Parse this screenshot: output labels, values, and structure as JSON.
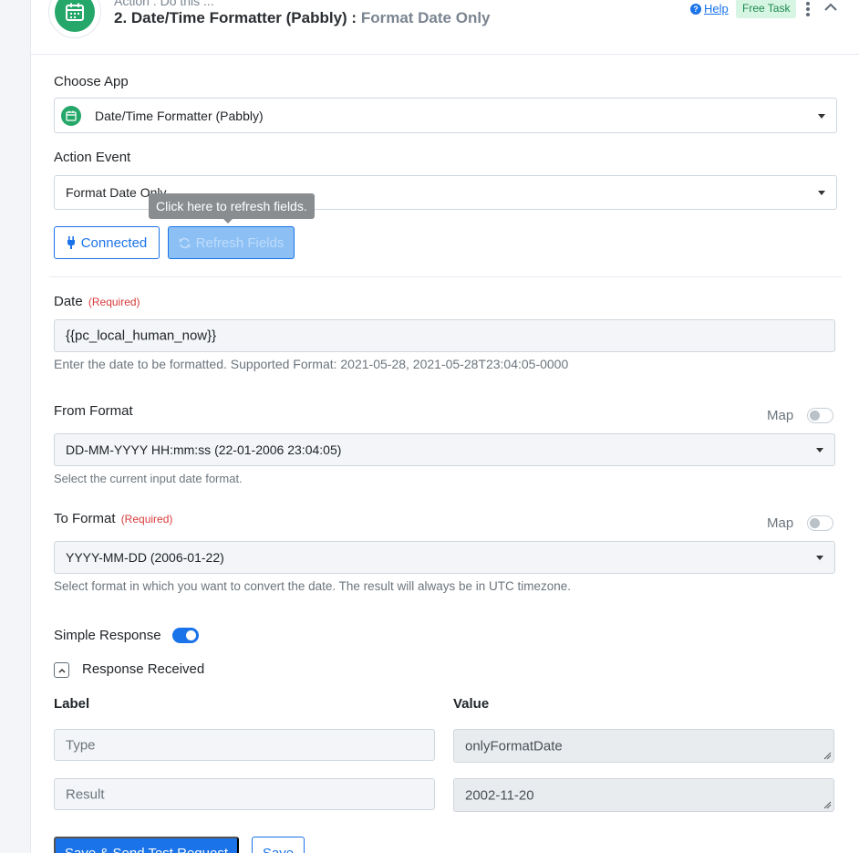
{
  "header": {
    "subtitle": "Action : Do this ...",
    "step_title": "2. Date/Time Formatter (Pabbly)",
    "separator": " : ",
    "event_name": "Format Date Only",
    "help_label": "Help",
    "badge": "Free Task"
  },
  "choose_app": {
    "label": "Choose App",
    "value": "Date/Time Formatter (Pabbly)"
  },
  "action_event": {
    "label": "Action Event",
    "value": "Format Date Only"
  },
  "buttons": {
    "connected": "Connected",
    "refresh": "Refresh Fields",
    "tooltip": "Click here to refresh fields.",
    "save_send": "Save & Send Test Request",
    "save": "Save"
  },
  "date_field": {
    "label": "Date",
    "required": "(Required)",
    "value": "{{pc_local_human_now}}",
    "hint": "Enter the date to be formatted. Supported Format: 2021-05-28, 2021-05-28T23:04:05-0000"
  },
  "from_format": {
    "label": "From Format",
    "map_label": "Map",
    "value": "DD-MM-YYYY HH:mm:ss (22-01-2006 23:04:05)",
    "hint": "Select the current input date format."
  },
  "to_format": {
    "label": "To Format",
    "required": "(Required)",
    "map_label": "Map",
    "value": "YYYY-MM-DD (2006-01-22)",
    "hint": "Select format in which you want to convert the date. The result will always be in UTC timezone."
  },
  "simple_response": {
    "label": "Simple Response",
    "enabled": true
  },
  "response": {
    "title": "Response Received",
    "col_label": "Label",
    "col_value": "Value",
    "rows": [
      {
        "label": "Type",
        "value": "onlyFormatDate"
      },
      {
        "label": "Result",
        "value": "2002-11-20"
      }
    ]
  },
  "colors": {
    "primary": "#1a73e8",
    "app_green": "#25a769",
    "required_red": "#d83a3a",
    "badge_bg": "#d6f5e3"
  },
  "icons": {
    "app": "calendar-icon",
    "help": "question-circle-icon",
    "kebab": "vertical-dots-icon",
    "collapse": "chevron-up-icon",
    "connected": "plug-icon",
    "refresh": "refresh-icon"
  }
}
